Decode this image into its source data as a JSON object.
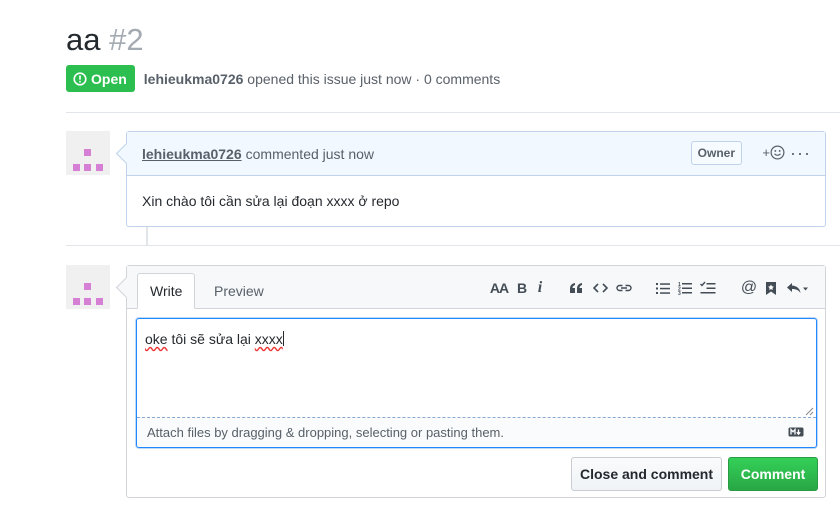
{
  "issue": {
    "title": "aa",
    "number": "#2",
    "state_label": "Open",
    "author": "lehieukma0726",
    "summary": "opened this issue just now · 0 comments"
  },
  "comment": {
    "author": "lehieukma0726",
    "action": "commented just now",
    "role_badge": "Owner",
    "reaction_plus": "+",
    "more": "···",
    "body": "Xin chào tôi cần sửa lại đoạn xxxx ở repo"
  },
  "composer": {
    "tabs": [
      {
        "label": "Write",
        "selected": true
      },
      {
        "label": "Preview",
        "selected": false
      }
    ],
    "toolbar": {
      "header_label": "AA",
      "bold_label": "B",
      "italic_label": "i",
      "items": [
        "header-icon",
        "bold-icon",
        "italic-icon",
        "quote-icon",
        "code-icon",
        "link-icon",
        "bulleted-list-icon",
        "numbered-list-icon",
        "task-list-icon",
        "mention-icon",
        "saved-reply-icon",
        "reply-arrow-icon"
      ]
    },
    "text_value": "oke tôi sẽ sửa lại xxxx",
    "text_parts": {
      "word1": "oke",
      "middle": " tôi sẽ sửa lại ",
      "word2": "xxxx"
    },
    "drop_hint": "Attach files by dragging & dropping, selecting or pasting them.",
    "markdown_icon": "markdown-icon",
    "close_button": "Close and comment",
    "submit_button": "Comment"
  },
  "colors": {
    "open_badge": "#2cbe4e",
    "comment_header": "#f1f8ff",
    "submit_green": "#2ea44f",
    "focus_blue": "#2188ff",
    "avatar_pink": "#d57fd5"
  }
}
